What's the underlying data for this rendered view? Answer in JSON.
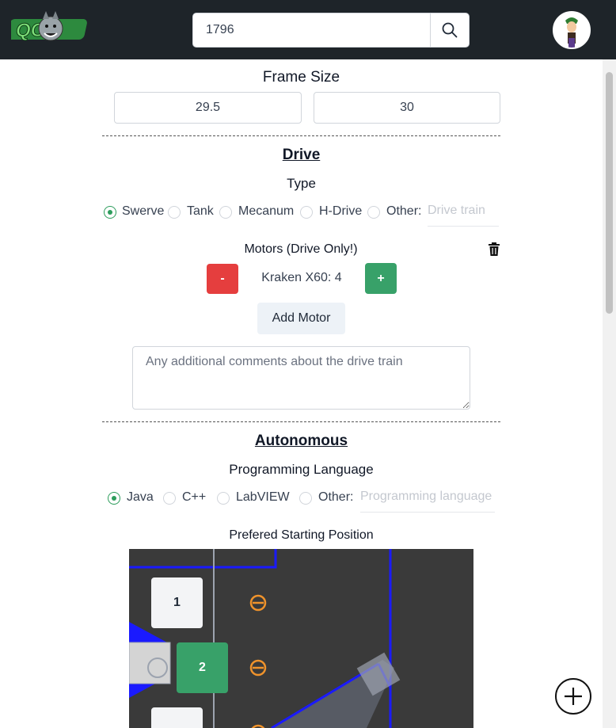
{
  "header": {
    "logo_text": "QOT",
    "search": {
      "value": "1796",
      "placeholder": ""
    },
    "icons": {
      "search": "search-icon",
      "avatar": "user-avatar",
      "logo": "team-logo"
    }
  },
  "frame": {
    "title": "Frame Size",
    "width": "29.5",
    "length": "30"
  },
  "drive": {
    "title": "Drive",
    "type_label": "Type",
    "types": [
      {
        "label": "Swerve",
        "selected": true
      },
      {
        "label": "Tank",
        "selected": false
      },
      {
        "label": "Mecanum",
        "selected": false
      },
      {
        "label": "H-Drive",
        "selected": false
      },
      {
        "label": "Other:",
        "selected": false
      }
    ],
    "other_placeholder": "Drive train",
    "motors_label": "Motors (Drive Only!)",
    "motor": {
      "name": "Kraken X60: 4",
      "minus": "-",
      "plus": "+"
    },
    "add_motor": "Add Motor",
    "comments_placeholder": "Any additional comments about the drive train"
  },
  "autonomous": {
    "title": "Autonomous",
    "language_label": "Programming Language",
    "languages": [
      {
        "label": "Java",
        "selected": true
      },
      {
        "label": "C++",
        "selected": false
      },
      {
        "label": "LabVIEW",
        "selected": false
      },
      {
        "label": "Other:",
        "selected": false
      }
    ],
    "other_placeholder": "Programming language",
    "start_label": "Prefered Starting Position",
    "positions": [
      {
        "label": "1",
        "selected": false
      },
      {
        "label": "2",
        "selected": true
      },
      {
        "label": "",
        "selected": false
      }
    ]
  },
  "colors": {
    "accent": "#38a169",
    "danger": "#e53e3e",
    "header": "#1e2429",
    "field": "#3a3a3a",
    "field_line": "#1a1aff",
    "marker": "#f0932b"
  },
  "fab": {
    "icon": "plus-circle-icon"
  }
}
